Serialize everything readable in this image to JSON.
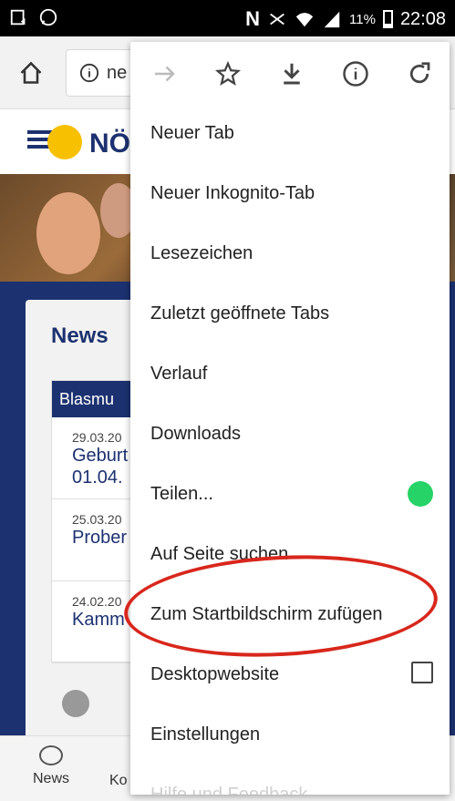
{
  "status": {
    "battery_pct": "11%",
    "time": "22:08"
  },
  "browser": {
    "url_text": "ne"
  },
  "site": {
    "logo_text": "NÖ",
    "news_title": "News",
    "panel_head": "Blasmu",
    "items": [
      {
        "date": "29.03.20",
        "line1": "Geburt",
        "line2": "01.04."
      },
      {
        "date": "25.03.20",
        "line1": "Prober",
        "line2": ""
      },
      {
        "date": "24.02.20",
        "line1": "Kamm",
        "line2": ""
      }
    ],
    "bottom_nav": [
      {
        "label": "News"
      },
      {
        "label": "Ko"
      }
    ]
  },
  "menu": {
    "items": [
      {
        "label": "Neuer Tab"
      },
      {
        "label": "Neuer Inkognito-Tab"
      },
      {
        "label": "Lesezeichen"
      },
      {
        "label": "Zuletzt geöffnete Tabs"
      },
      {
        "label": "Verlauf"
      },
      {
        "label": "Downloads"
      },
      {
        "label": "Teilen..."
      },
      {
        "label": "Auf Seite suchen"
      },
      {
        "label": "Zum Startbildschirm zufügen"
      },
      {
        "label": "Desktopwebsite"
      },
      {
        "label": "Einstellungen"
      },
      {
        "label": "Hilfe und Feedback"
      }
    ]
  },
  "colors": {
    "annotation": "#d8271c",
    "brand": "#1c3170",
    "accent": "#f7c000"
  }
}
